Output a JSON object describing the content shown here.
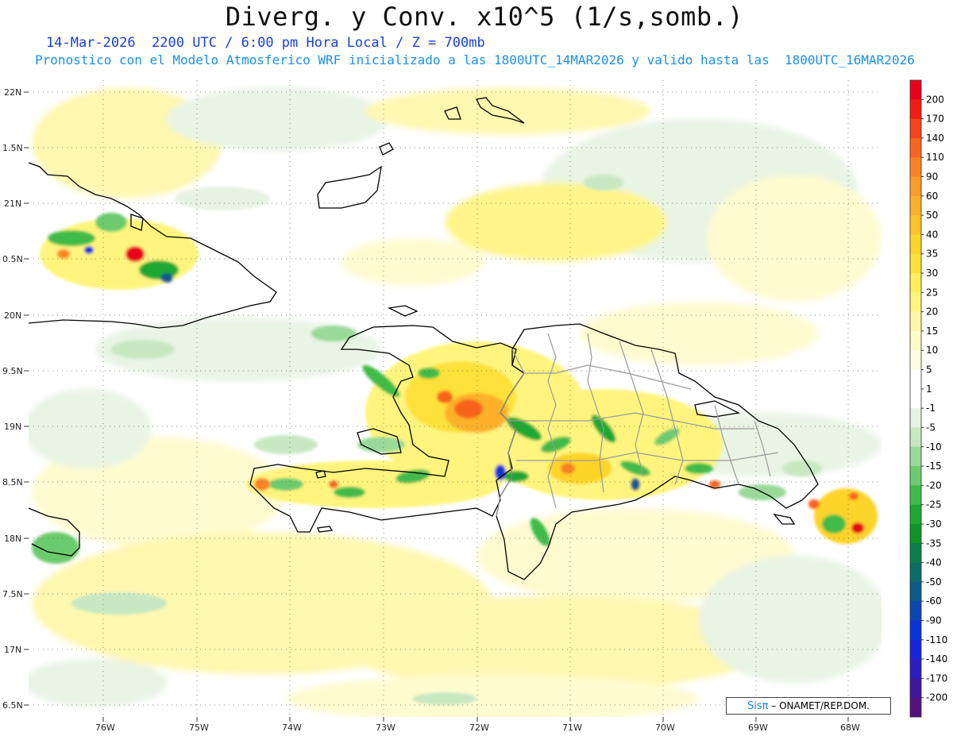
{
  "header": {
    "title": "Diverg. y Conv. x10^5 (1/s,somb.)",
    "subtitle_1": "14-Mar-2026  2200 UTC / 6:00 pm Hora Local / Z = 700mb",
    "subtitle_2": "Pronostico con el Modelo Atmosferico WRF inicializado a las 1800UTC_14MAR2026 y valido hasta las  1800UTC_16MAR2026"
  },
  "map": {
    "lat_labels": [
      "22N",
      "1.5N",
      "21N",
      "0.5N",
      "20N",
      "9.5N",
      "19N",
      "8.5N",
      "18N",
      "7.5N",
      "17N",
      "6.5N"
    ],
    "lon_labels": [
      "76W",
      "75W",
      "74W",
      "73W",
      "72W",
      "71W",
      "70W",
      "69W",
      "68W"
    ],
    "land_colors": {
      "coast": "#000000",
      "border": "#9a9a9a"
    }
  },
  "colorbar": {
    "labels": [
      "200",
      "170",
      "140",
      "110",
      "90",
      "60",
      "50",
      "40",
      "35",
      "30",
      "25",
      "20",
      "15",
      "10",
      "5",
      "1",
      "-1",
      "-5",
      "-10",
      "-15",
      "-20",
      "-25",
      "-30",
      "-35",
      "-40",
      "-50",
      "-60",
      "-90",
      "-110",
      "-140",
      "-170",
      "-200"
    ],
    "colors": [
      "#e8001c",
      "#f01d10",
      "#f5421a",
      "#f8641f",
      "#fa8224",
      "#fc9d29",
      "#fdb12b",
      "#fec42b",
      "#fdd42a",
      "#fee13a",
      "#fff05a",
      "#fff57e",
      "#fff8a8",
      "#fffbcc",
      "#fffde4",
      "#ffffff",
      "#ffffff",
      "#e6f3e2",
      "#c8e8c2",
      "#9ad99a",
      "#6ccb6e",
      "#3fbb48",
      "#1fa832",
      "#0f9328",
      "#0a7d4a",
      "#0a6c68",
      "#0b5a8c",
      "#0a46b4",
      "#0b34d8",
      "#1826d8",
      "#2a1cc0",
      "#3f159c",
      "#531080"
    ]
  },
  "credit": {
    "logo": "Sisπ",
    "text": "– ONAMET/REP.DOM."
  }
}
